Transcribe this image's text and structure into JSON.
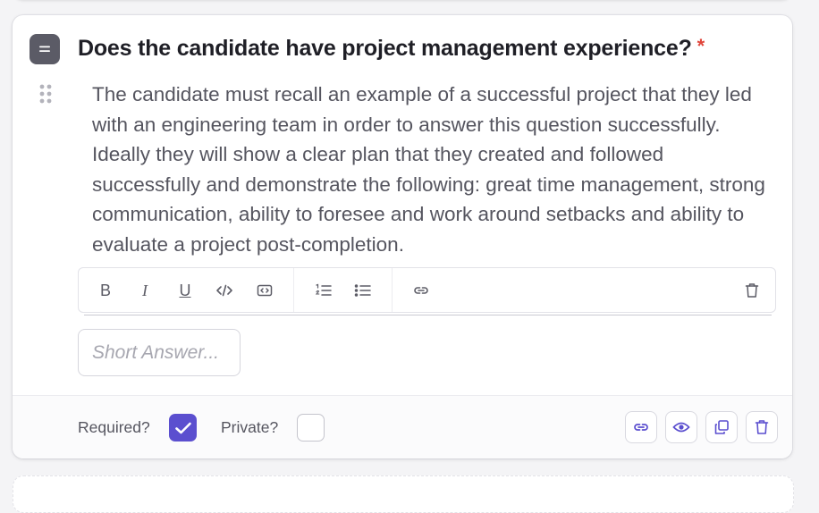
{
  "question": {
    "title": "Does the candidate have project management experience?",
    "required_marker": "*",
    "description": "The candidate must recall an example of a successful project that they led with an engineering team in order to answer this question successfully. Ideally they will show a clear plan that they created and followed successfully and demonstrate the following: great time management, strong communication, ability to foresee and work around setbacks and ability to evaluate a project post-completion.",
    "type_icon": "short-text-icon",
    "drag_icon": "drag-handle-icon"
  },
  "toolbar": {
    "bold": "B",
    "italic": "I",
    "underline": "U",
    "icons": [
      "code-icon",
      "code-block-icon",
      "ordered-list-icon",
      "bullet-list-icon",
      "link-icon",
      "trash-icon"
    ]
  },
  "answer": {
    "placeholder": "Short Answer..."
  },
  "footer": {
    "required_label": "Required?",
    "required_checked": true,
    "private_label": "Private?",
    "private_checked": false,
    "actions": [
      "link-icon",
      "preview-icon",
      "duplicate-icon",
      "delete-icon"
    ]
  },
  "colors": {
    "accent": "#5b4fcf",
    "required_star": "#e0453a",
    "type_icon_bg": "#5b5b66"
  }
}
